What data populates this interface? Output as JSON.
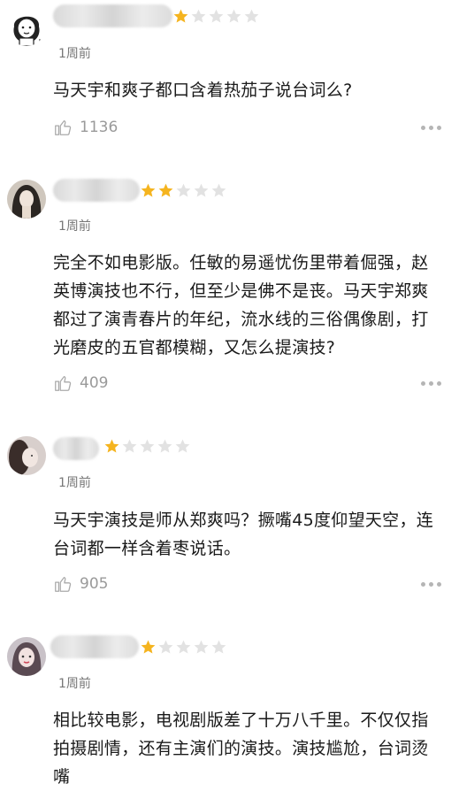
{
  "colors": {
    "star_filled": "#f5b41f",
    "star_empty": "#e2e2e2",
    "meta_gray": "#9a9a9a"
  },
  "reviews": [
    {
      "rating": 1,
      "time": "1周前",
      "content": "马天宇和爽子都口含着热茄子说台词么?",
      "likes": "1136",
      "avatar_icon": "cartoon-girl-avatar-icon"
    },
    {
      "rating": 2,
      "time": "1周前",
      "content": "完全不如电影版。任敏的易遥忧伤里带着倔强，赵英博演技也不行，但至少是佛不是丧。马天宇郑爽都过了演青春片的年纪，流水线的三俗偶像剧，打光磨皮的五官都模糊，又怎么提演技?",
      "likes": "409",
      "avatar_icon": "portrait-avatar-icon"
    },
    {
      "rating": 1,
      "time": "1周前",
      "content": "马天宇演技是师从郑爽吗？撅嘴45度仰望天空，连台词都一样含着枣说话。",
      "likes": "905",
      "avatar_icon": "portrait-avatar-icon"
    },
    {
      "rating": 1,
      "time": "1周前",
      "content": "相比较电影，电视剧版差了十万八千里。不仅仅指拍摄剧情，还有主演们的演技。演技尴尬，台词烫嘴",
      "likes": "",
      "avatar_icon": "portrait-avatar-icon"
    }
  ]
}
